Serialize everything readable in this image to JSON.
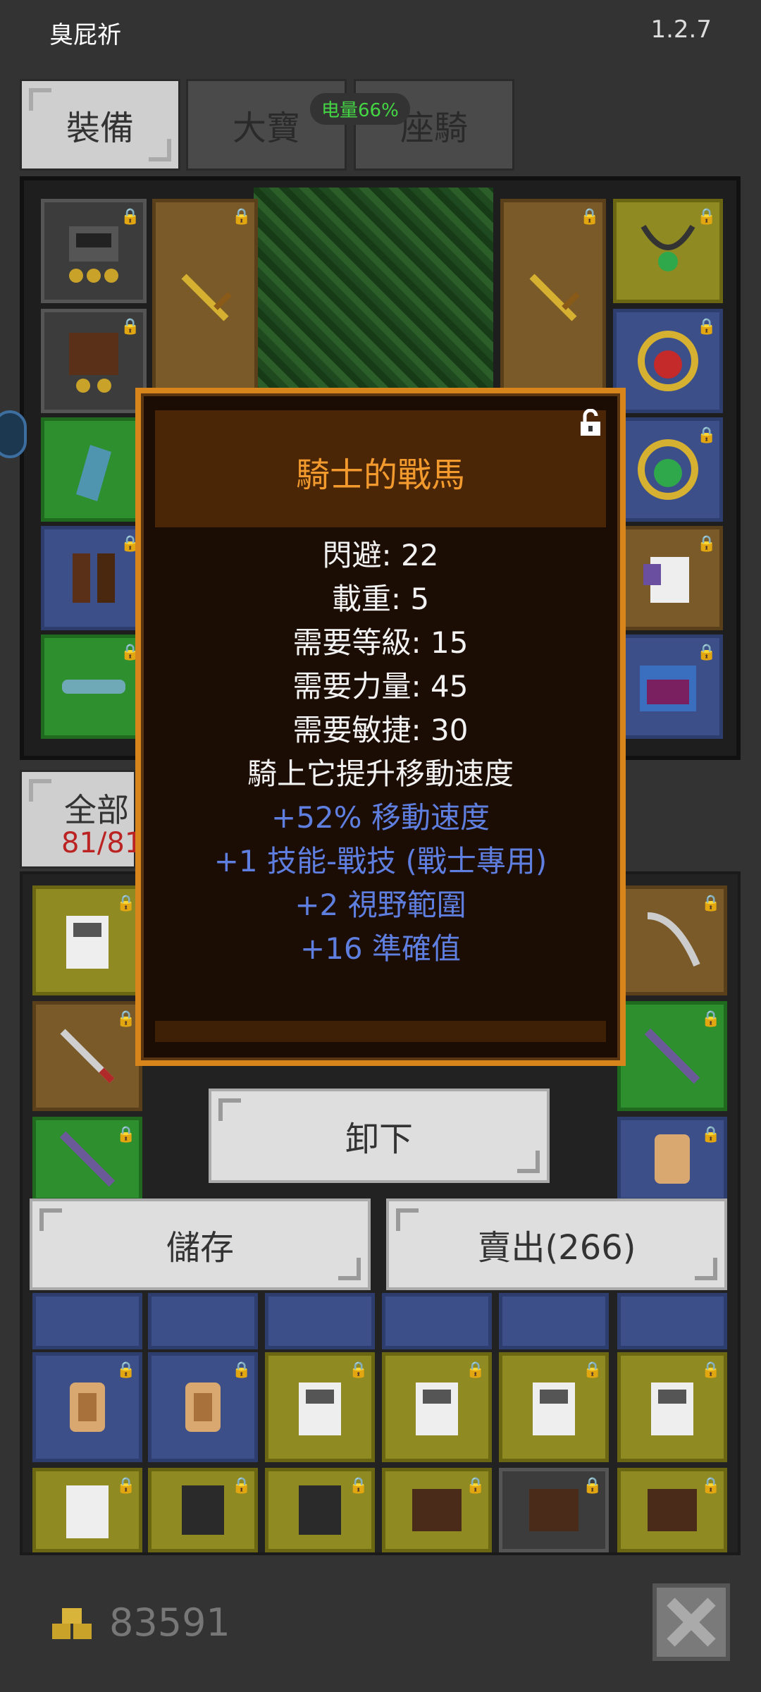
{
  "status_bar": {
    "app_name": "臭屁祈",
    "version": "1.2.7"
  },
  "tabs": [
    {
      "label": "裝備",
      "active": true
    },
    {
      "label": "大寶",
      "active": false
    },
    {
      "label": "座騎",
      "active": false
    }
  ],
  "battery": {
    "label": "电量66%"
  },
  "equipment_panel": {
    "slots": [
      {
        "name": "helmet",
        "color": "gray"
      },
      {
        "name": "armor",
        "color": "gray"
      },
      {
        "name": "cape",
        "color": "green"
      },
      {
        "name": "boots",
        "color": "blue"
      },
      {
        "name": "belt",
        "color": "green"
      },
      {
        "name": "weapon-left",
        "color": "brown"
      },
      {
        "name": "weapon-right",
        "color": "brown"
      },
      {
        "name": "necklace",
        "color": "yellow"
      },
      {
        "name": "ring-red",
        "color": "blue"
      },
      {
        "name": "ring-green",
        "color": "blue"
      },
      {
        "name": "mount",
        "color": "brown"
      },
      {
        "name": "chest",
        "color": "blue"
      }
    ]
  },
  "filter": {
    "label": "全部",
    "count": "81/81"
  },
  "dialog": {
    "title": "騎士的戰馬",
    "stats": [
      {
        "text": "閃避: 22",
        "color": "white"
      },
      {
        "text": "載重: 5",
        "color": "white"
      },
      {
        "text": "需要等級: 15",
        "color": "white"
      },
      {
        "text": "需要力量: 45",
        "color": "white"
      },
      {
        "text": "需要敏捷: 30",
        "color": "white"
      },
      {
        "text": "騎上它提升移動速度",
        "color": "white"
      },
      {
        "text": "+52% 移動速度",
        "color": "blue"
      },
      {
        "text": "+1 技能-戰技 (戰士專用)",
        "color": "blue"
      },
      {
        "text": "+2 視野範圍",
        "color": "blue"
      },
      {
        "text": "+16 準確值",
        "color": "blue"
      }
    ]
  },
  "actions": {
    "unequip_label": "卸下",
    "store_label": "儲存",
    "sell_label": "賣出(266)"
  },
  "footer": {
    "gold_amount": "83591"
  },
  "colors": {
    "dialog_border": "#d8861c",
    "dialog_title": "#f29a2e",
    "stat_white": "#f2f2f2",
    "stat_blue": "#5f7fe0"
  }
}
